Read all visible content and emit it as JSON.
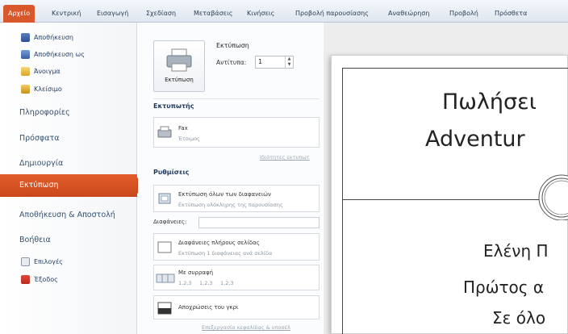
{
  "ribbon": {
    "file_tab": "Αρχείο",
    "tabs": [
      "Κεντρική",
      "Εισαγωγή",
      "Σχεδίαση",
      "Μεταβάσεις",
      "Κινήσεις",
      "Προβολή παρουσίασης",
      "Αναθεώρηση",
      "Προβολή",
      "Πρόσθετα"
    ]
  },
  "left_menu": {
    "save": "Αποθήκευση",
    "save_as": "Αποθήκευση ως",
    "open": "Άνοιγμα",
    "close": "Κλείσιμο",
    "info": "Πληροφορίες",
    "recent": "Πρόσφατα",
    "new": "Δημιουργία",
    "print": "Εκτύπωση",
    "save_send": "Αποθήκευση & Αποστολή",
    "help": "Βοήθεια",
    "options": "Επιλογές",
    "exit": "Έξοδος"
  },
  "print_panel": {
    "title": "Εκτύπωση",
    "print_button": "Εκτύπωση",
    "copies_label": "Αντίτυπα:",
    "copies_value": "1",
    "printer_heading": "Εκτυπωτής",
    "printer_name": "Fax",
    "printer_status": "Έτοιμος",
    "printer_props_link": "Ιδιότητες εκτυπωτ",
    "settings_heading": "Ρυθμίσεις",
    "print_all_title": "Εκτύπωση όλων των διαφανειών",
    "print_all_sub": "Εκτύπωση ολόκληρης της παρουσίασης",
    "slides_label": "Διαφάνειες:",
    "layout_title": "Διαφάνειες πλήρους σελίδας",
    "layout_sub": "Εκτύπωση 1 διαφάνειας ανά σελίδα",
    "collate_title": "Με συρραφή",
    "collate_sub": [
      "1,2,3",
      "1,2,3",
      "1,2,3"
    ],
    "color_title": "Αποχρώσεις του γκρι",
    "edit_link": "Επεξεργασία κεφαλίδας & υποσέλ"
  },
  "preview": {
    "title_line1": "Πωλήσει",
    "title_line2": "Adventur",
    "sub_line1": "Ελένη Π",
    "sub_line2": "Πρώτος α",
    "sub_line3": "Σε όλο"
  },
  "colors": {
    "accent": "#d9582b",
    "ribbon_text": "#2c3e57",
    "menu_text": "#1f3a5f"
  }
}
